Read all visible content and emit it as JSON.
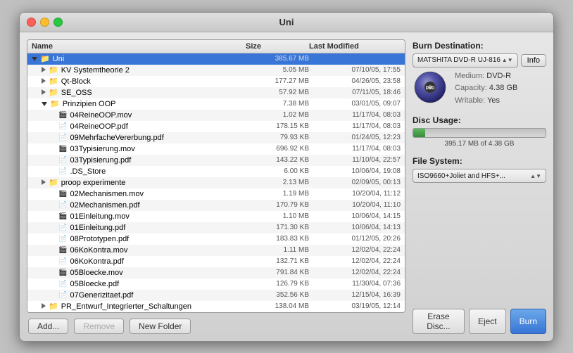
{
  "window": {
    "title": "Uni"
  },
  "header": {
    "name_col": "Name",
    "size_col": "Size",
    "modified_col": "Last Modified"
  },
  "files": [
    {
      "id": 1,
      "indent": 0,
      "type": "folder-open",
      "name": "Uni",
      "size": "385.67 MB",
      "date": "",
      "selected": true
    },
    {
      "id": 2,
      "indent": 1,
      "type": "folder",
      "name": "KV Systemtheorie 2",
      "size": "5.05 MB",
      "date": "07/10/05, 17:55"
    },
    {
      "id": 3,
      "indent": 1,
      "type": "folder",
      "name": "Qt-Block",
      "size": "177.27 MB",
      "date": "04/26/05, 23:58"
    },
    {
      "id": 4,
      "indent": 1,
      "type": "folder",
      "name": "SE_OSS",
      "size": "57.92 MB",
      "date": "07/11/05, 18:46"
    },
    {
      "id": 5,
      "indent": 1,
      "type": "folder-open",
      "name": "Prinzipien OOP",
      "size": "7.38 MB",
      "date": "03/01/05, 09:07"
    },
    {
      "id": 6,
      "indent": 2,
      "type": "movie",
      "name": "04ReineOOP.mov",
      "size": "1.02 MB",
      "date": "11/17/04, 08:03"
    },
    {
      "id": 7,
      "indent": 2,
      "type": "pdf",
      "name": "04ReineOOP.pdf",
      "size": "178.15 KB",
      "date": "11/17/04, 08:03"
    },
    {
      "id": 8,
      "indent": 2,
      "type": "pdf",
      "name": "09MehrfacheVererbung.pdf",
      "size": "79.93 KB",
      "date": "01/24/05, 12:23"
    },
    {
      "id": 9,
      "indent": 2,
      "type": "movie",
      "name": "03Typisierung.mov",
      "size": "696.92 KB",
      "date": "11/17/04, 08:03"
    },
    {
      "id": 10,
      "indent": 2,
      "type": "pdf",
      "name": "03Typisierung.pdf",
      "size": "143.22 KB",
      "date": "11/10/04, 22:57"
    },
    {
      "id": 11,
      "indent": 2,
      "type": "generic",
      "name": ".DS_Store",
      "size": "6.00 KB",
      "date": "10/06/04, 19:08"
    },
    {
      "id": 12,
      "indent": 1,
      "type": "folder",
      "name": "proop experimente",
      "size": "2.13 MB",
      "date": "02/09/05, 00:13"
    },
    {
      "id": 13,
      "indent": 2,
      "type": "movie",
      "name": "02Mechanismen.mov",
      "size": "1.19 MB",
      "date": "10/20/04, 11:12"
    },
    {
      "id": 14,
      "indent": 2,
      "type": "pdf",
      "name": "02Mechanismen.pdf",
      "size": "170.79 KB",
      "date": "10/20/04, 11:10"
    },
    {
      "id": 15,
      "indent": 2,
      "type": "movie",
      "name": "01Einleitung.mov",
      "size": "1.10 MB",
      "date": "10/06/04, 14:15"
    },
    {
      "id": 16,
      "indent": 2,
      "type": "pdf",
      "name": "01Einleitung.pdf",
      "size": "171.30 KB",
      "date": "10/06/04, 14:13"
    },
    {
      "id": 17,
      "indent": 2,
      "type": "pdf",
      "name": "08Prototypen.pdf",
      "size": "183.83 KB",
      "date": "01/12/05, 20:26"
    },
    {
      "id": 18,
      "indent": 2,
      "type": "movie",
      "name": "06KoKontra.mov",
      "size": "1.11 MB",
      "date": "12/02/04, 22:24"
    },
    {
      "id": 19,
      "indent": 2,
      "type": "pdf",
      "name": "06KoKontra.pdf",
      "size": "132.71 KB",
      "date": "12/02/04, 22:24"
    },
    {
      "id": 20,
      "indent": 2,
      "type": "movie",
      "name": "05Bloecke.mov",
      "size": "791.84 KB",
      "date": "12/02/04, 22:24"
    },
    {
      "id": 21,
      "indent": 2,
      "type": "pdf",
      "name": "05Bloecke.pdf",
      "size": "126.79 KB",
      "date": "11/30/04, 07:36"
    },
    {
      "id": 22,
      "indent": 2,
      "type": "pdf",
      "name": "07Generizitaet.pdf",
      "size": "352.56 KB",
      "date": "12/15/04, 16:39"
    },
    {
      "id": 23,
      "indent": 1,
      "type": "folder",
      "name": "PR_Entwurf_Integrierter_Schaltungen",
      "size": "138.04 MB",
      "date": "03/19/05, 12:14"
    }
  ],
  "buttons": {
    "add": "Add...",
    "remove": "Remove",
    "new_folder": "New Folder",
    "erase_disc": "Erase Disc...",
    "eject": "Eject",
    "burn": "Burn"
  },
  "right_panel": {
    "burn_dest_label": "Burn Destination:",
    "device_name": "MATSHITA DVD-R UJ-816",
    "info_label": "Info",
    "medium_label": "Medium:",
    "medium_value": "DVD-R",
    "capacity_label": "Capacity:",
    "capacity_value": "4.38 GB",
    "writable_label": "Writable:",
    "writable_value": "Yes",
    "disc_usage_label": "Disc Usage:",
    "disc_usage_value": "395.17 MB of 4.38 GB",
    "disc_usage_percent": 8.8,
    "file_system_label": "File System:",
    "file_system_value": "ISO9660+Joliet and HFS+..."
  }
}
